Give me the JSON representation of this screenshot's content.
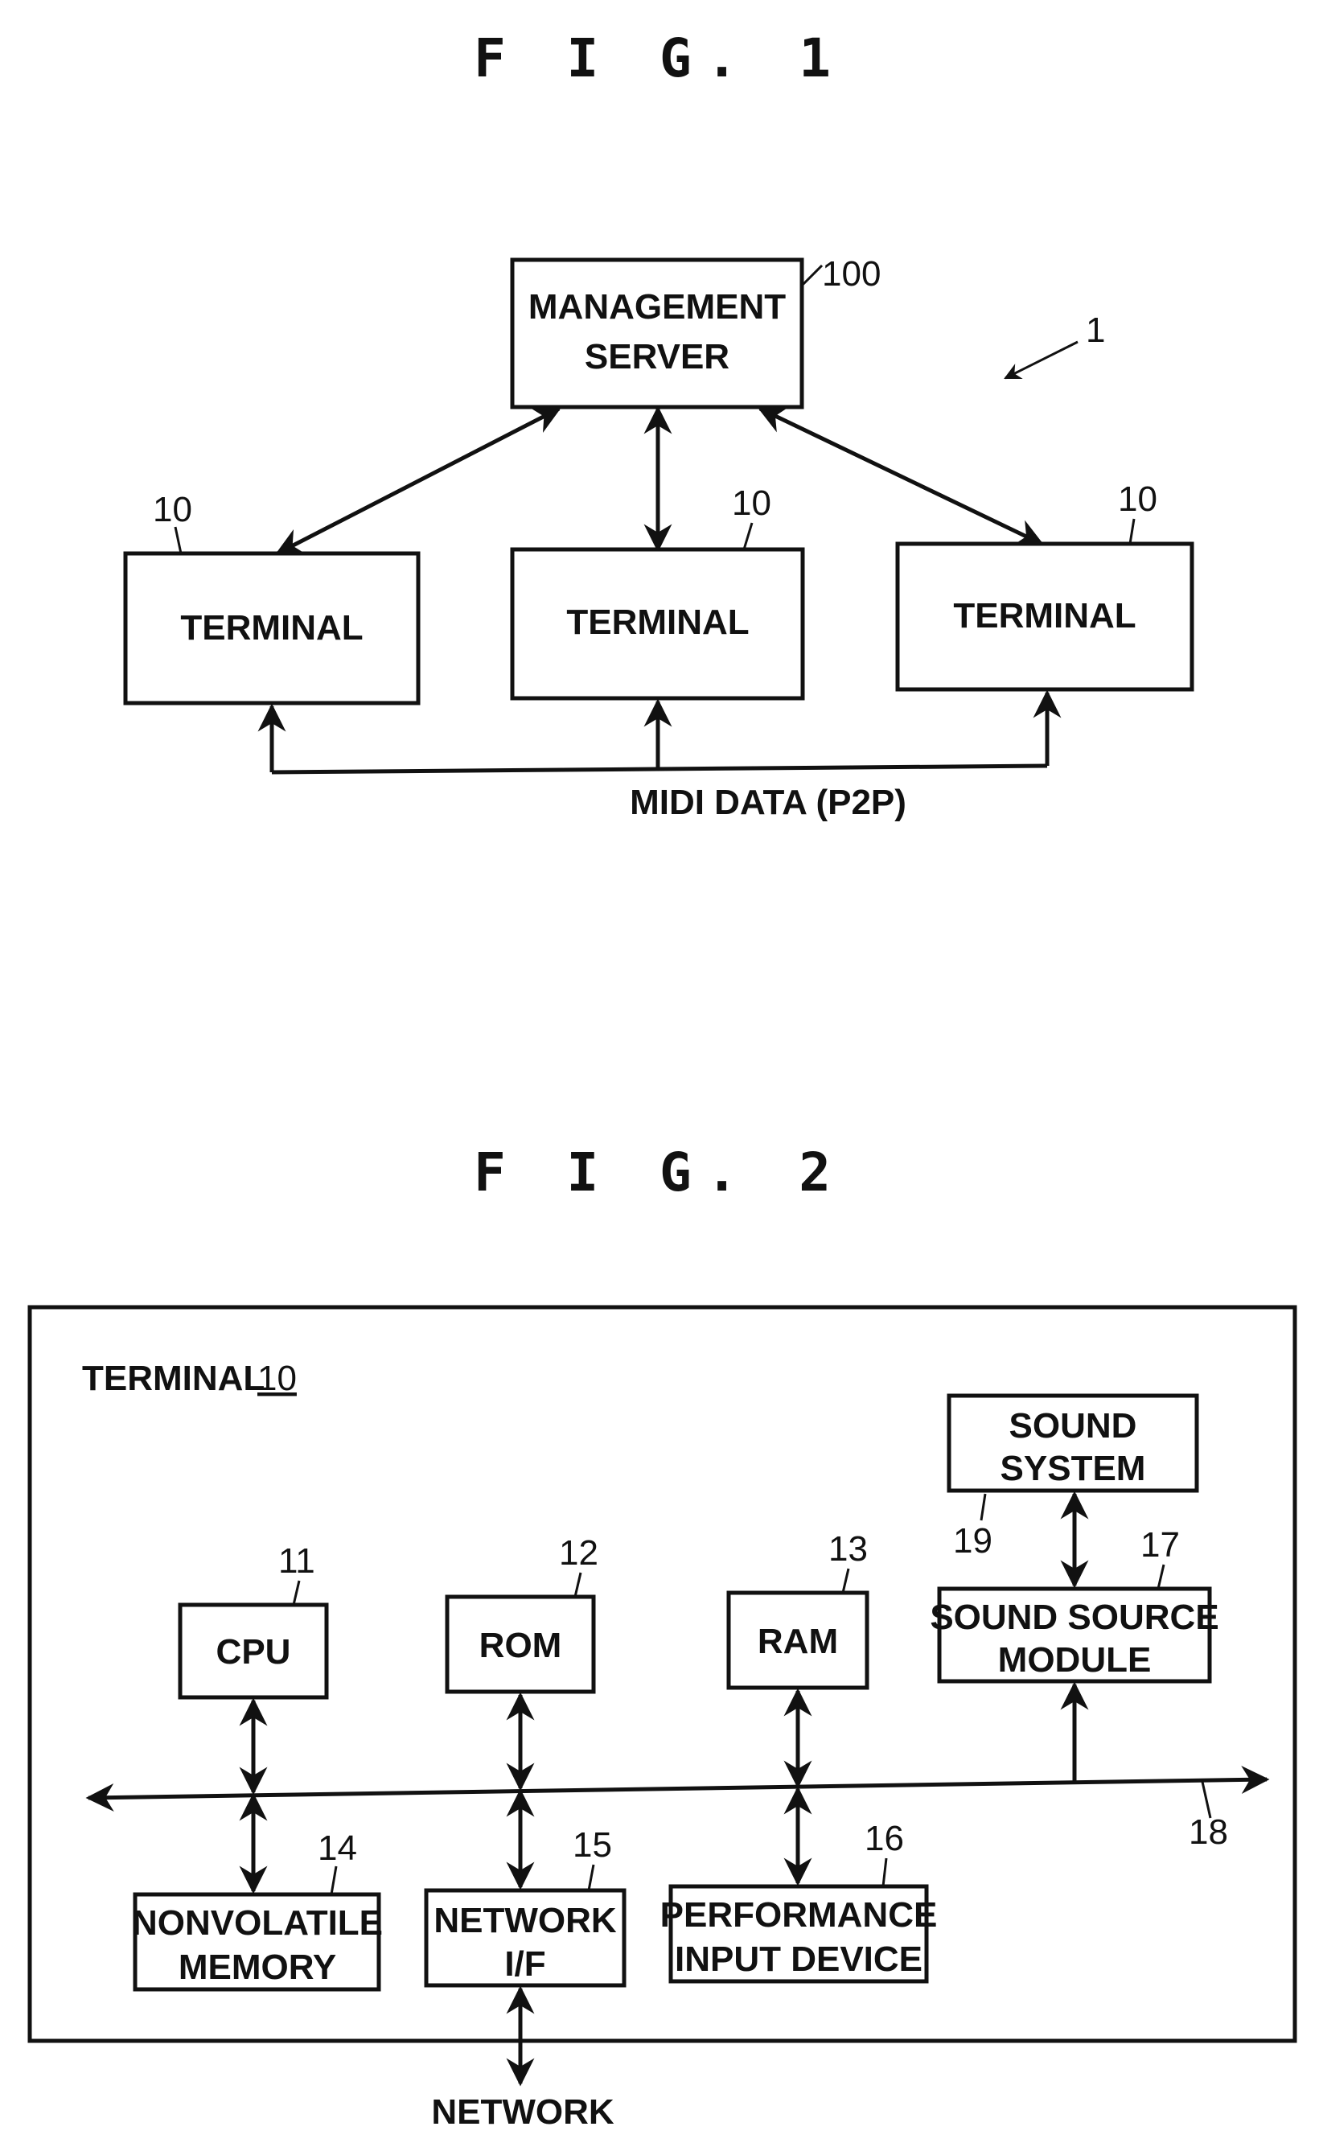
{
  "figure1": {
    "title": "F I G. 1",
    "system_ref": "1",
    "server": {
      "line1": "MANAGEMENT",
      "line2": "SERVER",
      "ref": "100"
    },
    "terminals": [
      {
        "label": "TERMINAL",
        "ref": "10"
      },
      {
        "label": "TERMINAL",
        "ref": "10"
      },
      {
        "label": "TERMINAL",
        "ref": "10"
      }
    ],
    "p2p_label": "MIDI DATA (P2P)"
  },
  "figure2": {
    "title": "F I G. 2",
    "container_label": "TERMINAL",
    "container_ref": "10",
    "blocks": {
      "cpu": {
        "label": "CPU",
        "ref": "11"
      },
      "rom": {
        "label": "ROM",
        "ref": "12"
      },
      "ram": {
        "label": "RAM",
        "ref": "13"
      },
      "nonvolatile": {
        "line1": "NONVOLATILE",
        "line2": "MEMORY",
        "ref": "14"
      },
      "network_if": {
        "line1": "NETWORK",
        "line2": "I/F",
        "ref": "15"
      },
      "performance": {
        "line1": "PERFORMANCE",
        "line2": "INPUT DEVICE",
        "ref": "16"
      },
      "sound_source": {
        "line1": "SOUND SOURCE",
        "line2": "MODULE",
        "ref": "17"
      },
      "sound_system": {
        "line1": "SOUND",
        "line2": "SYSTEM",
        "ref": "19"
      }
    },
    "bus_ref": "18",
    "network_label": "NETWORK"
  }
}
